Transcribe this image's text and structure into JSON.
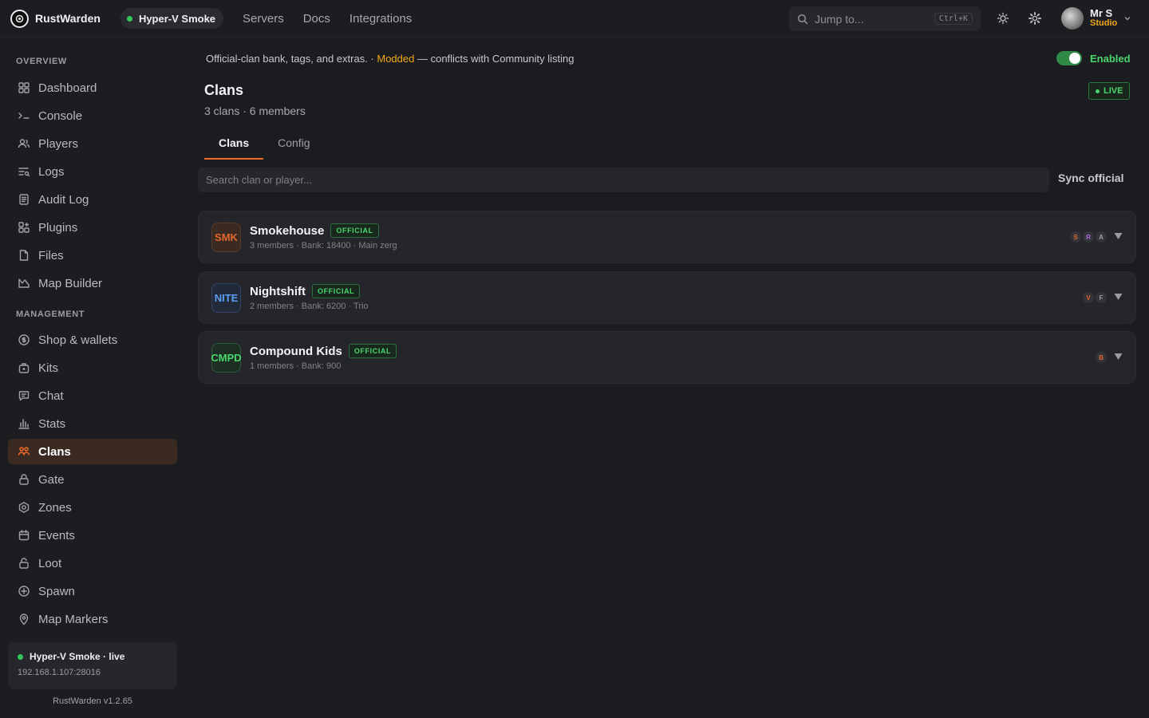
{
  "app": {
    "name": "RustWarden",
    "server_pill": "Hyper-V Smoke",
    "nav": [
      "Servers",
      "Docs",
      "Integrations"
    ],
    "jump_placeholder": "Jump to...",
    "shortcut": "Ctrl+K",
    "user_name": "Mr S",
    "user_org": "Studio"
  },
  "sidebar": {
    "overview_label": "OVERVIEW",
    "management_label": "MANAGEMENT",
    "overview": [
      {
        "label": "Dashboard",
        "icon": "grid-icon"
      },
      {
        "label": "Console",
        "icon": "terminal-icon"
      },
      {
        "label": "Players",
        "icon": "users-icon"
      },
      {
        "label": "Logs",
        "icon": "logs-icon"
      },
      {
        "label": "Audit Log",
        "icon": "document-icon"
      },
      {
        "label": "Plugins",
        "icon": "plugin-icon"
      },
      {
        "label": "Files",
        "icon": "file-icon"
      },
      {
        "label": "Map Builder",
        "icon": "map-icon"
      }
    ],
    "management": [
      {
        "label": "Shop & wallets",
        "icon": "coin-icon"
      },
      {
        "label": "Kits",
        "icon": "kit-icon"
      },
      {
        "label": "Chat",
        "icon": "chat-icon"
      },
      {
        "label": "Stats",
        "icon": "chart-icon"
      },
      {
        "label": "Clans",
        "icon": "clans-icon",
        "active": true
      },
      {
        "label": "Gate",
        "icon": "lock-icon"
      },
      {
        "label": "Zones",
        "icon": "zone-icon"
      },
      {
        "label": "Events",
        "icon": "calendar-icon"
      },
      {
        "label": "Loot",
        "icon": "loot-icon"
      },
      {
        "label": "Spawn",
        "icon": "spawn-icon"
      },
      {
        "label": "Map Markers",
        "icon": "pin-icon"
      }
    ],
    "status_title": "Hyper-V Smoke · live",
    "status_ip": "192.168.1.107:28016",
    "version": "RustWarden v1.2.65"
  },
  "main": {
    "notice_prefix": "Official-clan bank, tags, and extras. · ",
    "notice_modded": "Modded",
    "notice_suffix": " — conflicts with Community listing",
    "toggle_label": "Enabled",
    "live": "LIVE",
    "title": "Clans",
    "subtitle": "3 clans · 6 members",
    "tabs": [
      "Clans",
      "Config"
    ],
    "search_placeholder": "Search clan or player...",
    "sync_label": "Sync official",
    "official_label": "OFFICIAL"
  },
  "clans": [
    {
      "tag": "SMK",
      "name": "Smokehouse",
      "meta": "3 members · Bank: 18400 · Main zerg",
      "tag_color": "#e0662a",
      "tag_bg": "#3a2a22",
      "tag_border": "#5a3a28",
      "members": [
        {
          "l": "S",
          "c": "#e0662a"
        },
        {
          "l": "R",
          "c": "#b06ae0"
        },
        {
          "l": "A",
          "c": "#9a9ca2"
        }
      ]
    },
    {
      "tag": "NITE",
      "name": "Nightshift",
      "meta": "2 members · Bank: 6200 · Trio",
      "tag_color": "#5a9ef0",
      "tag_bg": "#222a3a",
      "tag_border": "#33466a",
      "members": [
        {
          "l": "V",
          "c": "#e0662a"
        },
        {
          "l": "F",
          "c": "#9a9ca2"
        }
      ]
    },
    {
      "tag": "CMPD",
      "name": "Compound Kids",
      "meta": "1 members · Bank: 900",
      "tag_color": "#4ad66d",
      "tag_bg": "#1d2e22",
      "tag_border": "#2c5a3a",
      "members": [
        {
          "l": "B",
          "c": "#e0662a"
        }
      ]
    }
  ]
}
